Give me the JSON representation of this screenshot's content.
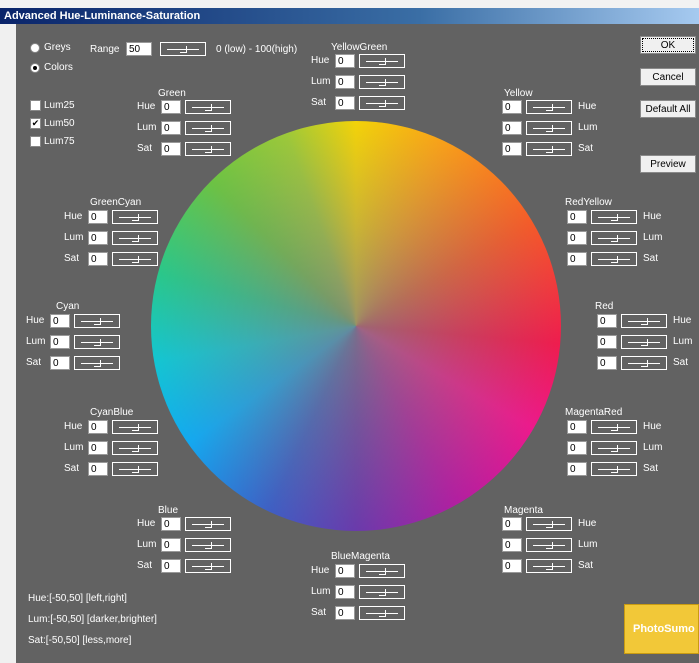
{
  "window": {
    "title": "Advanced Hue-Luminance-Saturation"
  },
  "mode": {
    "greys_label": "Greys",
    "colors_label": "Colors",
    "selected": "Colors"
  },
  "range": {
    "label": "Range",
    "value": "50",
    "hint": "0 (low) - 100(high)"
  },
  "lum_options": [
    {
      "label": "Lum25",
      "checked": false
    },
    {
      "label": "Lum50",
      "checked": true
    },
    {
      "label": "Lum75",
      "checked": false
    }
  ],
  "buttons": {
    "ok": "OK",
    "cancel": "Cancel",
    "default_all": "Default All",
    "preview": "Preview"
  },
  "field_labels": {
    "hue": "Hue",
    "lum": "Lum",
    "sat": "Sat"
  },
  "groups": {
    "yellowgreen": {
      "name": "YellowGreen",
      "hue": "0",
      "lum": "0",
      "sat": "0"
    },
    "green": {
      "name": "Green",
      "hue": "0",
      "lum": "0",
      "sat": "0"
    },
    "yellow": {
      "name": "Yellow",
      "hue": "0",
      "lum": "0",
      "sat": "0"
    },
    "greencyan": {
      "name": "GreenCyan",
      "hue": "0",
      "lum": "0",
      "sat": "0"
    },
    "redyellow": {
      "name": "RedYellow",
      "hue": "0",
      "lum": "0",
      "sat": "0"
    },
    "cyan": {
      "name": "Cyan",
      "hue": "0",
      "lum": "0",
      "sat": "0"
    },
    "red": {
      "name": "Red",
      "hue": "0",
      "lum": "0",
      "sat": "0"
    },
    "cyanblue": {
      "name": "CyanBlue",
      "hue": "0",
      "lum": "0",
      "sat": "0"
    },
    "magentared": {
      "name": "MagentaRed",
      "hue": "0",
      "lum": "0",
      "sat": "0"
    },
    "blue": {
      "name": "Blue",
      "hue": "0",
      "lum": "0",
      "sat": "0"
    },
    "magenta": {
      "name": "Magenta",
      "hue": "0",
      "lum": "0",
      "sat": "0"
    },
    "bluemagenta": {
      "name": "BlueMagenta",
      "hue": "0",
      "lum": "0",
      "sat": "0"
    }
  },
  "legend": {
    "hue": "Hue:[-50,50] [left,right]",
    "lum": "Lum:[-50,50] [darker,brighter]",
    "sat": "Sat:[-50,50] [less,more]"
  },
  "logo_text": "PhotoSumo"
}
